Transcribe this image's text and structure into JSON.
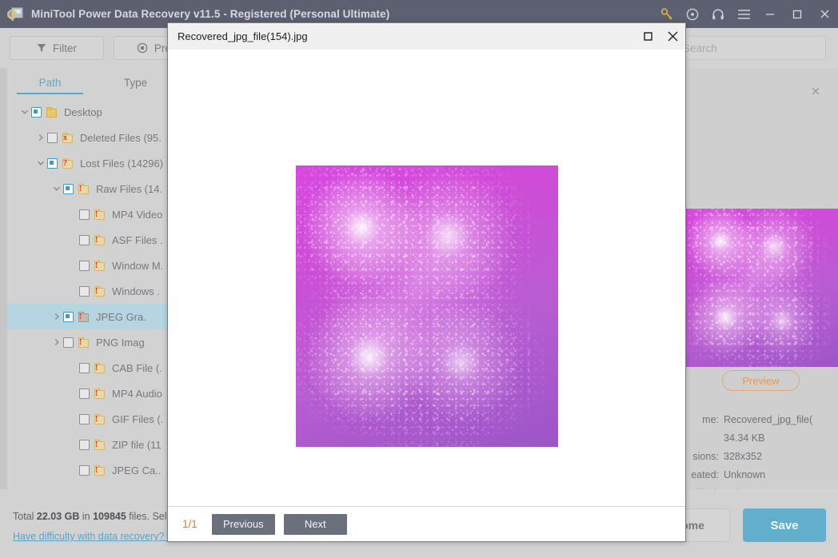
{
  "window": {
    "title": "MiniTool Power Data Recovery v11.5 - Registered (Personal Ultimate)",
    "icons": {
      "app": "app-logo-icon",
      "key": "key-icon",
      "disc": "disc-icon",
      "headphones": "headphones-icon",
      "menu": "hamburger-menu-icon",
      "minimize": "minimize-icon",
      "maximize": "maximize-icon",
      "close": "close-icon"
    }
  },
  "toolbar": {
    "filter_label": "Filter",
    "preview_label": "Previe",
    "filter_icon": "funnel-icon",
    "preview_icon": "eye-icon",
    "search_icon": "search-icon"
  },
  "search": {
    "placeholder": "Search",
    "value": ""
  },
  "sidebar": {
    "tabs": [
      {
        "label": "Path",
        "active": true
      },
      {
        "label": "Type",
        "active": false
      }
    ],
    "tree": [
      {
        "label": "Desktop",
        "indent": 0,
        "chevron": "down",
        "check": "partial",
        "folder": "plain",
        "mark": "",
        "selected": false
      },
      {
        "label": "Deleted Files (95.",
        "indent": 1,
        "chevron": "right",
        "check": "empty",
        "folder": "doc",
        "mark": "x",
        "selected": false
      },
      {
        "label": "Lost Files (14296)",
        "indent": 1,
        "chevron": "down",
        "check": "partial",
        "folder": "doc",
        "mark": "?",
        "selected": false
      },
      {
        "label": "Raw Files (14.",
        "indent": 2,
        "chevron": "down",
        "check": "partial",
        "folder": "doc",
        "mark": "!",
        "selected": false
      },
      {
        "label": "MP4 Video",
        "indent": 3,
        "chevron": "none",
        "check": "empty",
        "folder": "doc",
        "mark": "!",
        "selected": false
      },
      {
        "label": "ASF Files .",
        "indent": 3,
        "chevron": "none",
        "check": "empty",
        "folder": "doc",
        "mark": "!",
        "selected": false
      },
      {
        "label": "Window M.",
        "indent": 3,
        "chevron": "none",
        "check": "empty",
        "folder": "doc",
        "mark": "!",
        "selected": false
      },
      {
        "label": "Windows .",
        "indent": 3,
        "chevron": "none",
        "check": "empty",
        "folder": "doc",
        "mark": "!",
        "selected": false
      },
      {
        "label": "JPEG Gra.",
        "indent": 2,
        "chevron": "right",
        "check": "partial",
        "folder": "gray",
        "mark": "!",
        "selected": true
      },
      {
        "label": "PNG Imag",
        "indent": 2,
        "chevron": "right",
        "check": "empty",
        "folder": "doc",
        "mark": "!",
        "selected": false
      },
      {
        "label": "CAB File (.",
        "indent": 3,
        "chevron": "none",
        "check": "empty",
        "folder": "doc",
        "mark": "!",
        "selected": false
      },
      {
        "label": "MP4 Audio",
        "indent": 3,
        "chevron": "none",
        "check": "empty",
        "folder": "doc",
        "mark": "!",
        "selected": false
      },
      {
        "label": "GIF Files (.",
        "indent": 3,
        "chevron": "none",
        "check": "empty",
        "folder": "doc",
        "mark": "!",
        "selected": false
      },
      {
        "label": "ZIP file (11",
        "indent": 3,
        "chevron": "none",
        "check": "empty",
        "folder": "doc",
        "mark": "!",
        "selected": false
      },
      {
        "label": "JPEG Ca..",
        "indent": 3,
        "chevron": "none",
        "check": "empty",
        "folder": "doc",
        "mark": "!",
        "selected": false
      }
    ]
  },
  "detail_panel": {
    "close_icon": "close-icon",
    "preview_label": "Preview",
    "rows": [
      {
        "key": "me:",
        "value": "Recovered_jpg_file(\u0001"
      },
      {
        "key": "",
        "value": "34.34 KB"
      },
      {
        "key": "sions:",
        "value": "328x352"
      },
      {
        "key": "eated:",
        "value": "Unknown"
      },
      {
        "key": "odified:",
        "value": "Unknown"
      }
    ]
  },
  "status": {
    "total_prefix": "Total ",
    "total_size": "22.03 GB",
    "total_middle": " in ",
    "total_files": "109845",
    "total_suffix": " files.  Sele",
    "help_link": "Have difficulty with data recovery? C"
  },
  "actions": {
    "home_label": "ome",
    "save_label": "Save"
  },
  "modal": {
    "title": "Recovered_jpg_file(154).jpg",
    "maximize_icon": "maximize-icon",
    "close_icon": "close-icon",
    "page_indicator": "1/1",
    "previous_label": "Previous",
    "next_label": "Next",
    "image_alt": "fireworks-photo"
  },
  "colors": {
    "titlebar": "#5d6070",
    "app_bg": "#d2d2d2",
    "accent_blue": "#62afcd",
    "accent_orange": "#e07b33",
    "key_gold": "#e0b33c",
    "selection": "#b6d5e3",
    "link": "#5aa3c6",
    "preview_border": "#e0a878"
  }
}
